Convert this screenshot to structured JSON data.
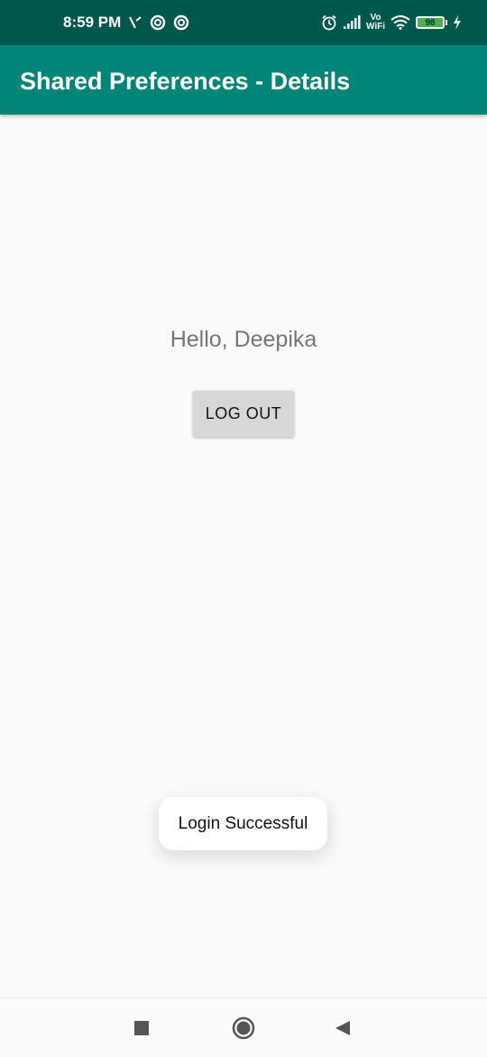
{
  "status_bar": {
    "time": "8:59 PM",
    "volte_top": "Vo",
    "volte_bottom": "WiFi",
    "battery_level": "98"
  },
  "app_bar": {
    "title": "Shared Preferences - Details"
  },
  "main": {
    "greeting": "Hello, Deepika",
    "logout_label": "LOG OUT"
  },
  "toast": {
    "message": "Login Successful"
  },
  "colors": {
    "status_bar": "#00574b",
    "app_bar": "#008577",
    "background": "#fafafa",
    "button": "#d6d7d7"
  },
  "nav_bar": {
    "icons": [
      "recents-square-icon",
      "home-circle-icon",
      "back-triangle-icon"
    ]
  }
}
